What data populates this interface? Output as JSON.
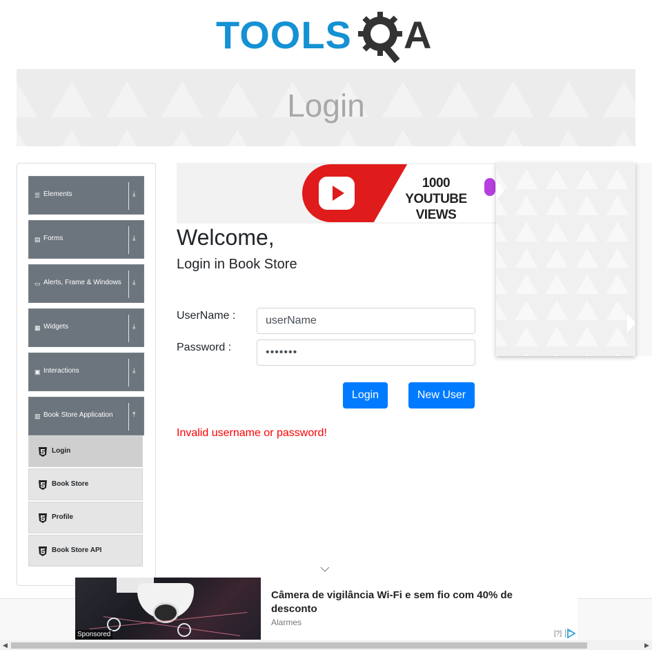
{
  "logo": {
    "text": "TOOLS",
    "suffix": "A",
    "brand_color": "#1591d4",
    "icon": "gear-magnifier-icon"
  },
  "banner": {
    "title": "Login"
  },
  "sidebar": {
    "groups": [
      {
        "label": "Elements",
        "icon": "hamburger-icon",
        "arrow": "⤓"
      },
      {
        "label": "Forms",
        "icon": "document-icon",
        "arrow": "⤓"
      },
      {
        "label": "Alerts, Frame & Windows",
        "icon": "window-icon",
        "arrow": "⤓"
      },
      {
        "label": "Widgets",
        "icon": "grid-icon",
        "arrow": "⤓"
      },
      {
        "label": "Interactions",
        "icon": "box-icon",
        "arrow": "⤓"
      },
      {
        "label": "Book Store Application",
        "icon": "books-icon",
        "arrow": "⤒"
      }
    ],
    "items": [
      {
        "label": "Login",
        "active": true
      },
      {
        "label": "Book Store"
      },
      {
        "label": "Profile"
      },
      {
        "label": "Book Store API"
      }
    ]
  },
  "top_ad": {
    "text_line1": "1000",
    "text_line2": "YOUTUBE VIEWS"
  },
  "form": {
    "welcome": "Welcome,",
    "subtitle": "Login in Book Store",
    "username_label": "UserName :",
    "username_value": "userName",
    "password_label": "Password :",
    "password_value": "•••••••",
    "login_button": "Login",
    "new_user_button": "New User",
    "error": "Invalid username or password!",
    "accent": "#007bff",
    "error_color": "#ff0000"
  },
  "bottom_ad": {
    "title": "Câmera de vigilância Wi-Fi e sem fio com 40% de desconto",
    "source": "Alarmes",
    "sponsored": "Sponsored",
    "info": "[?]"
  }
}
